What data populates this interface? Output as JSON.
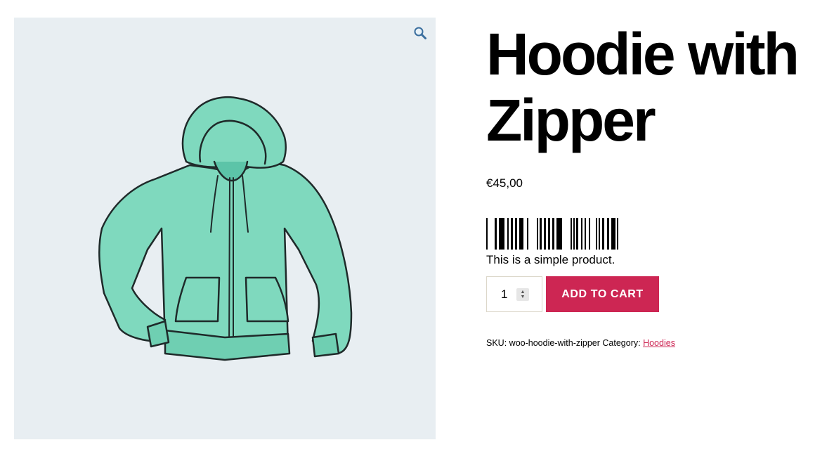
{
  "gallery": {
    "zoom_icon": "magnifier-icon",
    "image_alt": "Hoodie with Zipper"
  },
  "product": {
    "title_line1": "Hoodie with",
    "title_line2": "Zipper",
    "price": "€45,00",
    "short_description": "This is a simple product.",
    "barcode_icon": "barcode-icon"
  },
  "cart": {
    "quantity": "1",
    "add_to_cart_label": "ADD TO CART"
  },
  "meta": {
    "sku_label": "SKU:",
    "sku_value": "woo-hoodie-with-zipper",
    "category_label": "Category:",
    "category_link": "Hoodies"
  },
  "colors": {
    "accent": "#cd2653",
    "gallery_bg": "#e8eef2",
    "hoodie": "#7fd9be"
  }
}
